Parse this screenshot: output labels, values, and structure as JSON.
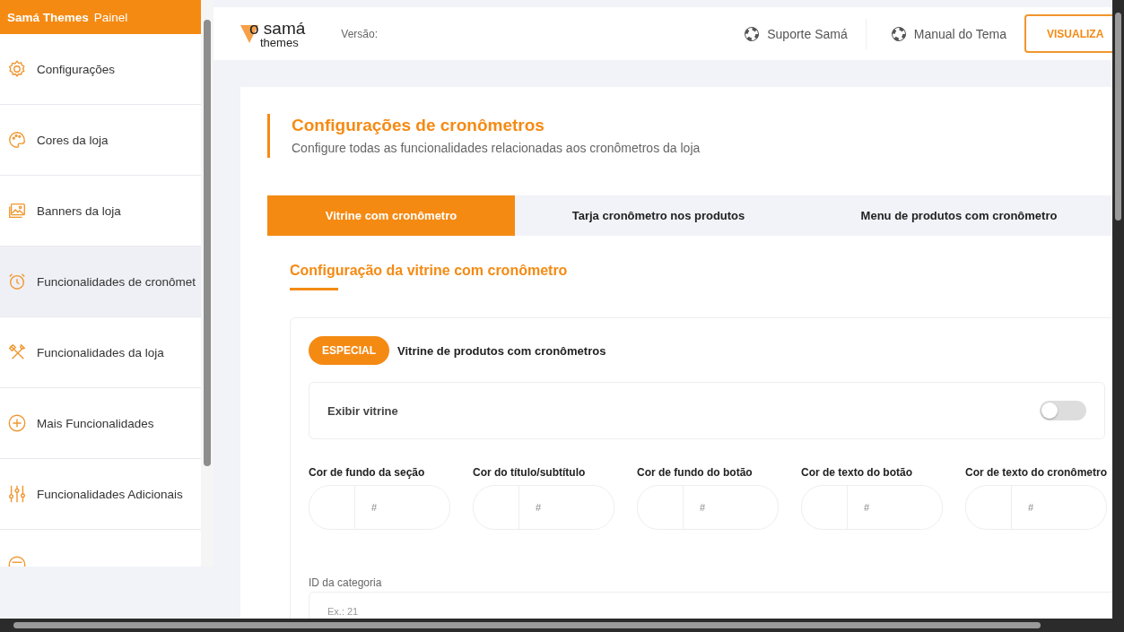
{
  "sidebar": {
    "brand": "Samá Themes",
    "subtitle": "Painel",
    "items": [
      {
        "label": "Configurações",
        "selected": false
      },
      {
        "label": "Cores da loja",
        "selected": false
      },
      {
        "label": "Banners da loja",
        "selected": false
      },
      {
        "label": "Funcionalidades de cronômet",
        "selected": true
      },
      {
        "label": "Funcionalidades da loja",
        "selected": false
      },
      {
        "label": "Mais Funcionalidades",
        "selected": false
      },
      {
        "label": "Funcionalidades Adicionais",
        "selected": false
      },
      {
        "selected": false
      }
    ]
  },
  "header": {
    "logo": {
      "line1": "o samá",
      "line2": "themes"
    },
    "version_label": "Versão:",
    "links": [
      "Suporte Samá",
      "Manual do Tema"
    ],
    "preview_button": "VISUALIZA"
  },
  "page": {
    "title": "Configurações de cronômetros",
    "subtitle": "Configure todas as funcionalidades relacionadas aos cronômetros da loja"
  },
  "tabs": [
    {
      "label": "Vitrine com cronômetro",
      "selected": true
    },
    {
      "label": "Tarja cronômetro nos produtos",
      "selected": false
    },
    {
      "label": "Menu de produtos com cronômetro",
      "selected": false
    }
  ],
  "section": {
    "title": "Configuração da vitrine com cronômetro",
    "badge": "ESPECIAL",
    "badge_label": "Vitrine de produtos com cronômetros",
    "toggle": {
      "label": "Exibir vitrine",
      "on": false
    },
    "color_fields": [
      {
        "label": "Cor de fundo da seção",
        "placeholder": "#"
      },
      {
        "label": "Cor do título/subtítulo",
        "placeholder": "#"
      },
      {
        "label": "Cor de fundo do botão",
        "placeholder": "#"
      },
      {
        "label": "Cor de texto do botão",
        "placeholder": "#"
      },
      {
        "label": "Cor de texto do cronômetro",
        "placeholder": "#"
      }
    ],
    "category": {
      "label": "ID da categoria",
      "placeholder": "Ex.: 21"
    }
  }
}
